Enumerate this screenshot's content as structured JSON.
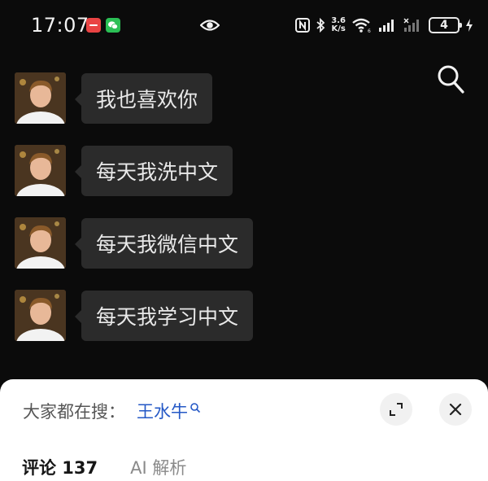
{
  "status_bar": {
    "time": "17:07",
    "net_speed_value": "3.6",
    "net_speed_unit": "K/s",
    "battery": "4",
    "icons": [
      "app-notification-icon",
      "wechat-icon",
      "eye-icon",
      "nfc-icon",
      "bluetooth-icon",
      "wifi-icon",
      "signal-icon",
      "battery-icon",
      "charging-icon"
    ]
  },
  "header": {
    "search_icon": "search-icon"
  },
  "chat": {
    "messages": [
      {
        "text": "我也喜欢你"
      },
      {
        "text": "每天我洗中文"
      },
      {
        "text": "每天我微信中文"
      },
      {
        "text": "每天我学习中文"
      }
    ]
  },
  "sheet": {
    "search_prefix": "大家都在搜：",
    "search_term": "王水牛",
    "tabs": [
      {
        "label": "评论 137",
        "active": true
      },
      {
        "label": "AI 解析",
        "active": false
      }
    ]
  },
  "colors": {
    "background": "#0b0b0b",
    "bubble": "#2b2b2b",
    "link": "#2458c6",
    "sheet": "#ffffff"
  }
}
